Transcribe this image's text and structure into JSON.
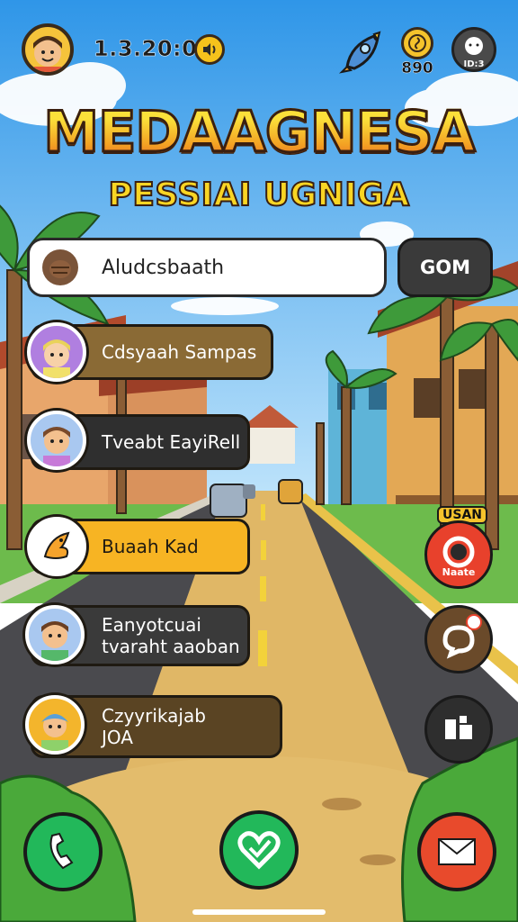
{
  "hud": {
    "score": "1.3.20:03",
    "coins": "890",
    "profile_label": "ID:3"
  },
  "title": {
    "main": "MEDAAGNESA",
    "sub": "PESSIAI UGNIGA"
  },
  "search": {
    "value": "Aludcsbaath",
    "button_label": "GOM"
  },
  "contacts": [
    {
      "lines": [
        "Cdsyaah Sampas"
      ],
      "color": "#8a6a35"
    },
    {
      "lines": [
        "Tveabt EayiRell"
      ],
      "color": "#2f2f2f"
    },
    {
      "lines": [
        "Buaah Kad"
      ],
      "color": "#f7b423"
    },
    {
      "lines": [
        "Eanyotcuai",
        "tvaraht aaoban"
      ],
      "color": "#3a3a3a"
    },
    {
      "lines": [
        "Czyyrikajab",
        "JOA"
      ],
      "color": "#5a4423"
    }
  ],
  "side": {
    "badge_label": "USAN",
    "camera_label": "Naate"
  },
  "colors": {
    "sky": "#3fa3ee",
    "road": "#4a4a4e",
    "ground": "#e3bc6c",
    "call": "#22b85a",
    "mail": "#e84a2c"
  },
  "icons": [
    "rocket-icon",
    "coin-icon",
    "sound-icon",
    "phone-icon",
    "heart-icon",
    "mail-icon",
    "camera-icon",
    "share-icon",
    "chat-icon"
  ]
}
